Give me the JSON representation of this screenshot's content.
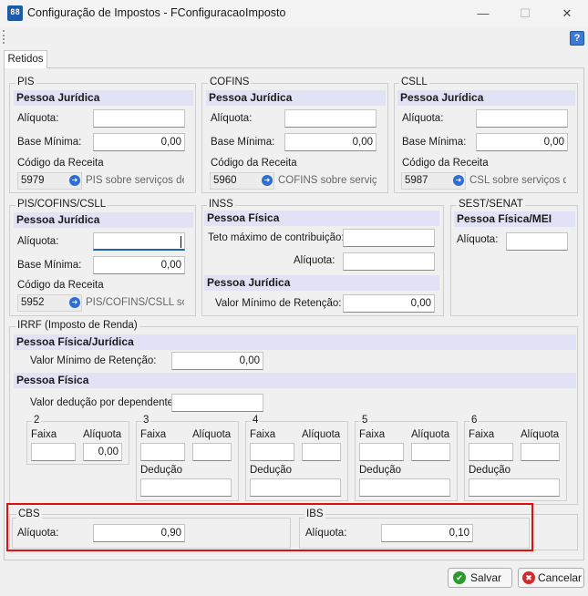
{
  "window": {
    "title": "Configuração de Impostos - FConfiguracaoImposto",
    "app_icon_text": "88"
  },
  "toolbar": {
    "help": "?"
  },
  "tabs": [
    {
      "label": "Retidos"
    }
  ],
  "pis": {
    "title": "PIS",
    "section": "Pessoa Jurídica",
    "aliquota_label": "Alíquota:",
    "aliquota": "",
    "base_label": "Base Mínima:",
    "base": "0,00",
    "codigo_label": "Código da Receita",
    "codigo": "5979",
    "descricao": "PIS sobre serviços de"
  },
  "cofins": {
    "title": "COFINS",
    "section": "Pessoa Jurídica",
    "aliquota_label": "Alíquota:",
    "aliquota": "",
    "base_label": "Base Mínima:",
    "base": "0,00",
    "codigo_label": "Código da Receita",
    "codigo": "5960",
    "descricao": "COFINS sobre serviços"
  },
  "csll": {
    "title": "CSLL",
    "section": "Pessoa Jurídica",
    "aliquota_label": "Alíquota:",
    "aliquota": "",
    "base_label": "Base Mínima:",
    "base": "0,00",
    "codigo_label": "Código da Receita",
    "codigo": "5987",
    "descricao": "CSL sobre serviços de"
  },
  "pcc": {
    "title": "PIS/COFINS/CSLL",
    "section": "Pessoa Jurídica",
    "aliquota_label": "Alíquota:",
    "aliquota": "",
    "base_label": "Base Mínima:",
    "base": "0,00",
    "codigo_label": "Código da Receita",
    "codigo": "5952",
    "descricao": "PIS/COFINS/CSLL sobr"
  },
  "inss": {
    "title": "INSS",
    "section_pf": "Pessoa Física",
    "teto_label": "Teto máximo de contribuição:",
    "teto": "",
    "aliquota_label": "Alíquota:",
    "aliquota": "",
    "section_pj": "Pessoa Jurídica",
    "valor_min_label": "Valor Mínimo de Retenção:",
    "valor_min": "0,00"
  },
  "sest": {
    "title": "SEST/SENAT",
    "section": "Pessoa Física/MEI",
    "aliquota_label": "Alíquota:",
    "aliquota": ""
  },
  "irrf": {
    "title": "IRRF (Imposto de Renda)",
    "section_pfj": "Pessoa Física/Jurídica",
    "valor_min_label": "Valor Mínimo de Retenção:",
    "valor_min": "0,00",
    "section_pf": "Pessoa Física",
    "deducao_dep_label": "Valor dedução por dependente:",
    "deducao_dep": "",
    "faixas": [
      {
        "num": "2",
        "faixa_label": "Faixa",
        "aliquota_label": "Alíquota",
        "faixa": "",
        "aliquota": "0,00"
      },
      {
        "num": "3",
        "faixa_label": "Faixa",
        "aliquota_label": "Alíquota",
        "faixa": "",
        "aliquota": "",
        "deducao_label": "Dedução",
        "deducao": ""
      },
      {
        "num": "4",
        "faixa_label": "Faixa",
        "aliquota_label": "Alíquota",
        "faixa": "",
        "aliquota": "",
        "deducao_label": "Dedução",
        "deducao": ""
      },
      {
        "num": "5",
        "faixa_label": "Faixa",
        "aliquota_label": "Alíquota",
        "faixa": "",
        "aliquota": "",
        "deducao_label": "Dedução",
        "deducao": ""
      },
      {
        "num": "6",
        "faixa_label": "Faixa",
        "aliquota_label": "Alíquota",
        "faixa": "",
        "aliquota": "",
        "deducao_label": "Dedução",
        "deducao": ""
      }
    ]
  },
  "cbs": {
    "title": "CBS",
    "aliquota_label": "Alíquota:",
    "aliquota": "0,90"
  },
  "ibs": {
    "title": "IBS",
    "aliquota_label": "Alíquota:",
    "aliquota": "0,10"
  },
  "buttons": {
    "save": "Salvar",
    "cancel": "Cancelar"
  },
  "colors": {
    "band": "#e2e2f6",
    "highlight": "#e01010",
    "accent": "#2060b0"
  }
}
